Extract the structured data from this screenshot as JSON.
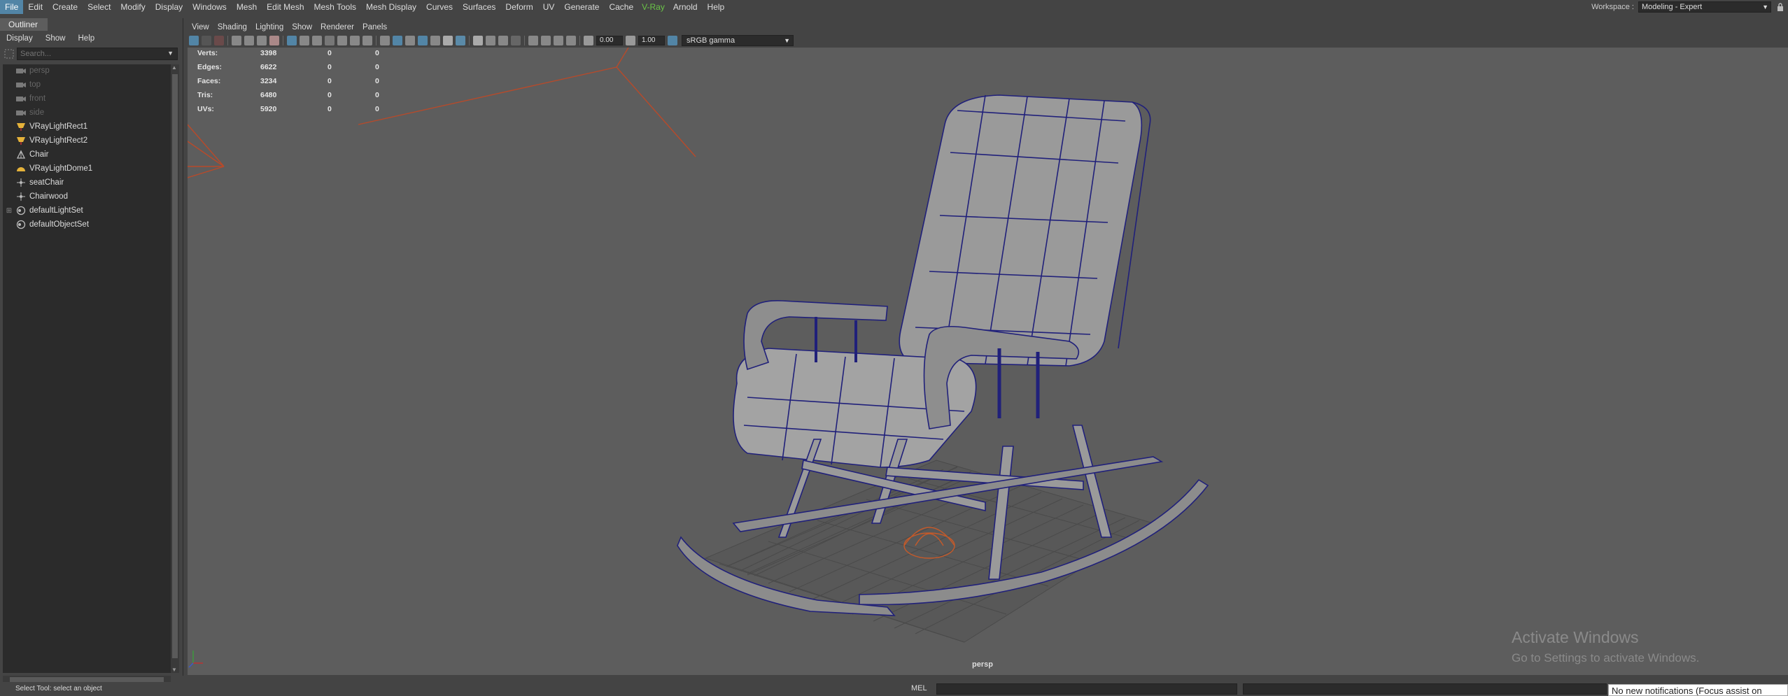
{
  "menu": [
    "File",
    "Edit",
    "Create",
    "Select",
    "Modify",
    "Display",
    "Windows",
    "Mesh",
    "Edit Mesh",
    "Mesh Tools",
    "Mesh Display",
    "Curves",
    "Surfaces",
    "Deform",
    "UV",
    "Generate",
    "Cache",
    "V-Ray",
    "Arnold",
    "Help"
  ],
  "workspace": {
    "label": "Workspace :",
    "value": "Modeling - Expert"
  },
  "outliner": {
    "tab": "Outliner",
    "menu": [
      "Display",
      "Show",
      "Help"
    ],
    "search_placeholder": "Search...",
    "items": [
      {
        "label": "persp",
        "icon": "camera-icon",
        "dim": true
      },
      {
        "label": "top",
        "icon": "camera-icon",
        "dim": true
      },
      {
        "label": "front",
        "icon": "camera-icon",
        "dim": true
      },
      {
        "label": "side",
        "icon": "camera-icon",
        "dim": true
      },
      {
        "label": "VRayLightRect1",
        "icon": "area-light-icon",
        "dim": false
      },
      {
        "label": "VRayLightRect2",
        "icon": "area-light-icon",
        "dim": false
      },
      {
        "label": "Chair",
        "icon": "mesh-icon",
        "dim": false
      },
      {
        "label": "VRayLightDome1",
        "icon": "dome-light-icon",
        "dim": false
      },
      {
        "label": "seatChair",
        "icon": "group-icon",
        "dim": false
      },
      {
        "label": "Chairwood",
        "icon": "group-icon",
        "dim": false
      },
      {
        "label": "defaultLightSet",
        "icon": "set-icon",
        "dim": false,
        "expandable": true
      },
      {
        "label": "defaultObjectSet",
        "icon": "set-icon",
        "dim": false
      }
    ]
  },
  "viewport": {
    "menu": [
      "View",
      "Shading",
      "Lighting",
      "Show",
      "Renderer",
      "Panels"
    ],
    "exposure": "0.00",
    "gamma": "1.00",
    "color_management": "sRGB gamma",
    "camera": "persp",
    "hud": [
      {
        "label": "Verts:",
        "v1": "3398",
        "v2": "0",
        "v3": "0"
      },
      {
        "label": "Edges:",
        "v1": "6622",
        "v2": "0",
        "v3": "0"
      },
      {
        "label": "Faces:",
        "v1": "3234",
        "v2": "0",
        "v3": "0"
      },
      {
        "label": "Tris:",
        "v1": "6480",
        "v2": "0",
        "v3": "0"
      },
      {
        "label": "UVs:",
        "v1": "5920",
        "v2": "0",
        "v3": "0"
      }
    ]
  },
  "watermark": {
    "line1": "Activate Windows",
    "line2": "Go to Settings to activate Windows."
  },
  "status": {
    "message": "Select Tool: select an object",
    "mel": "MEL"
  },
  "notification": "No new notifications (Focus assist on"
}
